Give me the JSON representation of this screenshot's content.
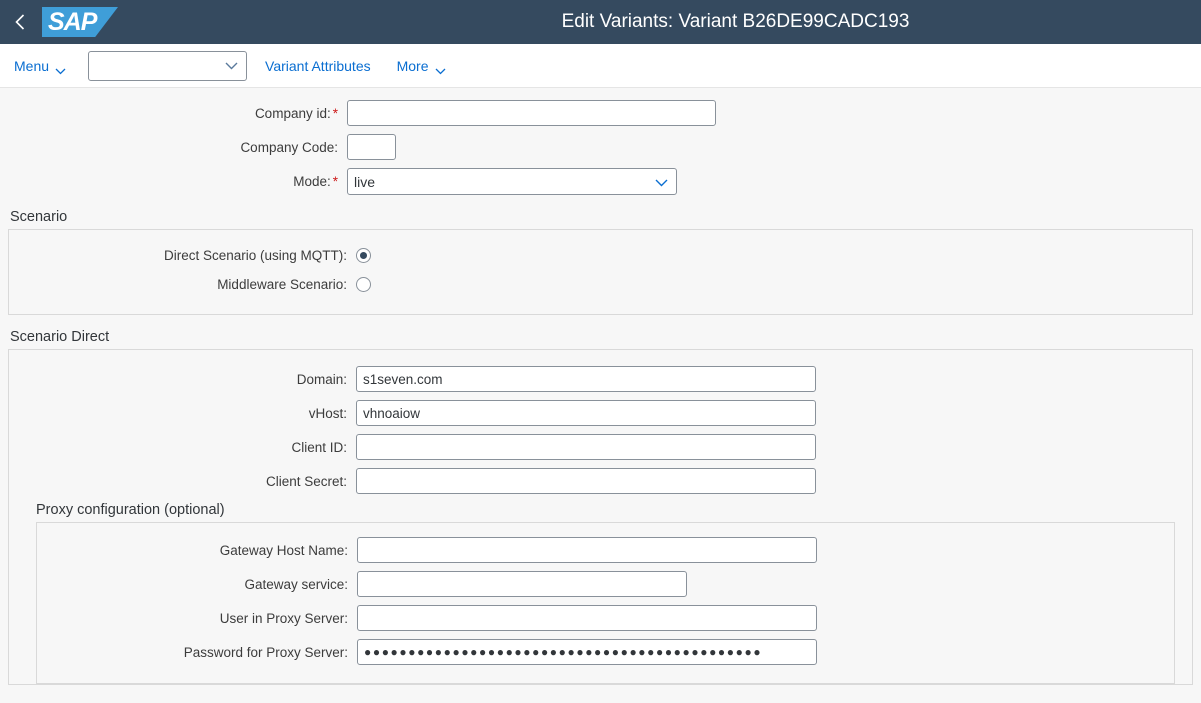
{
  "header": {
    "title": "Edit Variants: Variant B26DE99CADC193",
    "logo_text": "SAP",
    "back_icon": "back-chevron-icon"
  },
  "toolbar": {
    "menu_label": "Menu",
    "variant_select_value": "",
    "variant_attributes_label": "Variant Attributes",
    "more_label": "More"
  },
  "form": {
    "company_id": {
      "label": "Company id:",
      "required": "*",
      "value": ""
    },
    "company_code": {
      "label": "Company Code:",
      "value": ""
    },
    "mode": {
      "label": "Mode:",
      "required": "*",
      "value": "live"
    }
  },
  "scenario": {
    "title": "Scenario",
    "direct": {
      "label": "Direct Scenario (using MQTT):",
      "selected": true
    },
    "middleware": {
      "label": "Middleware Scenario:",
      "selected": false
    }
  },
  "scenario_direct": {
    "title": "Scenario Direct",
    "fields": [
      {
        "label": "Domain:",
        "value": "s1seven.com"
      },
      {
        "label": "vHost:",
        "value": "vhnoaiow"
      },
      {
        "label": "Client ID:",
        "value": ""
      },
      {
        "label": "Client Secret:",
        "value": ""
      }
    ],
    "proxy": {
      "title": "Proxy configuration (optional)",
      "fields": [
        {
          "label": "Gateway Host Name:",
          "value": ""
        },
        {
          "label": "Gateway service:",
          "value": ""
        },
        {
          "label": "User in Proxy Server:",
          "value": ""
        }
      ],
      "password": {
        "label": "Password for Proxy Server:",
        "value": "●●●●●●●●●●●●●●●●●●●●●●●●●●●●●●●●●●●●●●●●●●●●●"
      }
    }
  },
  "colors": {
    "header_bg": "#354a5f",
    "logo_blue": "#3f9ed8",
    "link_blue": "#0a6ed1",
    "required_red": "#cc1919",
    "radio_selected": "#354a5f"
  }
}
